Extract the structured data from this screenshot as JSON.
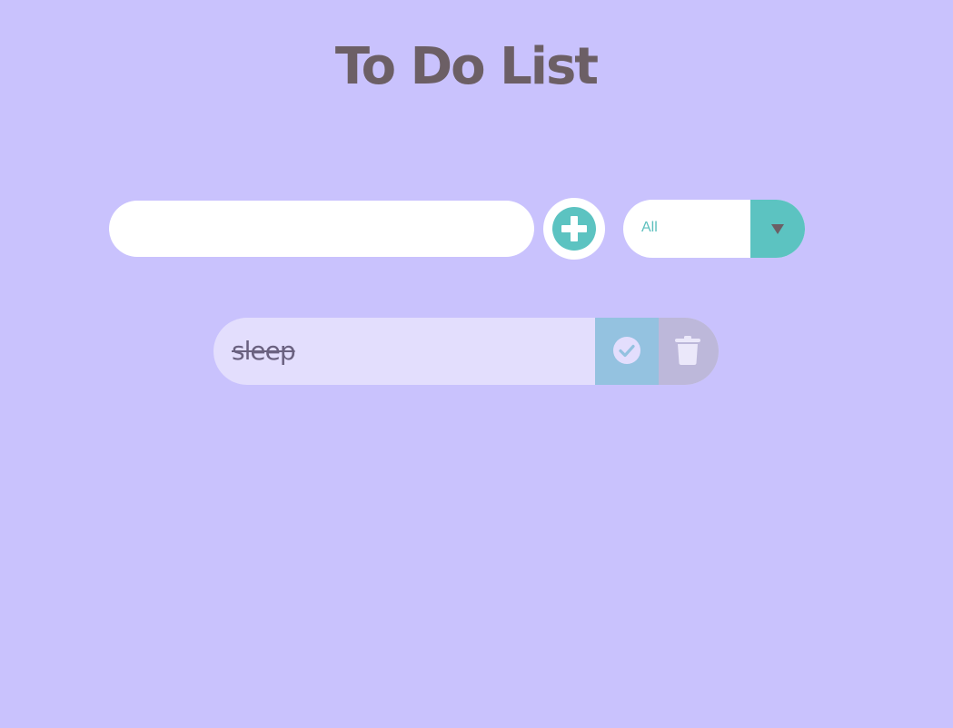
{
  "header": {
    "title": "To Do List"
  },
  "form": {
    "input_value": "",
    "input_placeholder": "",
    "add_icon": "plus-circle-icon",
    "filter_selected": "All",
    "filter_arrow_icon": "caret-down-icon"
  },
  "todos": [
    {
      "text": "sleep",
      "completed": true,
      "complete_icon": "check-circle-icon",
      "delete_icon": "trash-icon"
    }
  ],
  "colors": {
    "background": "#c9c2fd",
    "title": "#6c5f65",
    "accent": "#5cc3c1",
    "todo_item": "#e3defd",
    "complete_button": "#94c2e0",
    "trash_button": "#bdb8da"
  }
}
